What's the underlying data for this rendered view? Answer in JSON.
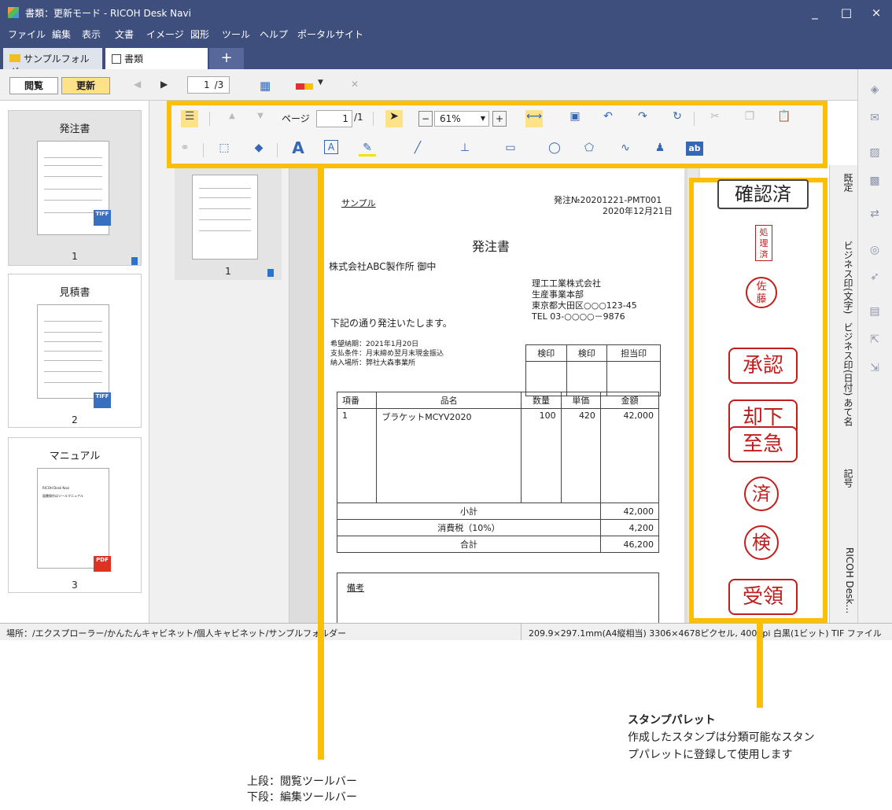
{
  "titlebar": {
    "title": "書類：更新モード - RICOH Desk Navi",
    "minimize": "_",
    "maximize": "□",
    "close": "×"
  },
  "menu": [
    "ファイル",
    "編集",
    "表示",
    "文書",
    "イメージ",
    "図形",
    "ツール",
    "ヘルプ",
    "ポータルサイト"
  ],
  "tabs": {
    "folder": "サンプルフォルダー",
    "docs": "書類",
    "add": "+"
  },
  "mainbar": {
    "browse": "閲覧",
    "update": "更新",
    "page": "1",
    "total": "/3"
  },
  "toolbar": {
    "page_label": "ページ",
    "page_value": "1",
    "page_total": "/1",
    "zoom": "61%",
    "text_tool": "A",
    "textbox_tool": "A",
    "ab_tool": "ab"
  },
  "left_docs": [
    {
      "title": "発注書",
      "number": "1",
      "format": "TIFF"
    },
    {
      "title": "見積書",
      "number": "2",
      "format": "TIFF"
    },
    {
      "title": "マニュアル",
      "number": "3",
      "format": "PDF"
    }
  ],
  "mid_thumb": {
    "number": "1"
  },
  "manual_thumb": {
    "line1": "RICOH Desk Navi",
    "line2": "図書操作はツールマニュアル"
  },
  "document": {
    "sample": "サンプル",
    "order_no": "発注№20201221-PMT001",
    "date": "2020年12月21日",
    "title": "発注書",
    "recipient": "株式会社ABC製作所  御中",
    "company": "理工工業株式会社",
    "department": "生産事業本部",
    "address": "東京都大田区○○○123-45",
    "tel": "TEL  03-○○○○－9876",
    "intro": "下記の通り発注いたします。",
    "delivery": "希望納期：2021年1月20日",
    "payment": "支払条件：月末締め翌月末現金振込",
    "place": "納入場所：弊社大森事業所",
    "approvals": [
      "検印",
      "検印",
      "担当印"
    ],
    "columns": [
      "項番",
      "品名",
      "数量",
      "単価",
      "金額"
    ],
    "rows": [
      {
        "no": "1",
        "name": "ブラケットMCYV2020",
        "qty": "100",
        "price": "420",
        "amount": "42,000"
      }
    ],
    "subtotal_label": "小計",
    "subtotal": "42,000",
    "tax_label": "消費税（10%）",
    "tax": "4,200",
    "total_label": "合計",
    "total": "46,200",
    "remarks": "備考"
  },
  "stamps": [
    "確認済",
    "処",
    "理",
    "済",
    "佐",
    "藤",
    "承認",
    "却下",
    "至急",
    "済",
    "検",
    "受領"
  ],
  "vtabs": [
    "既定",
    "ビジネス印(文字)",
    "ビジネス印(日付)",
    "あて名",
    "記号",
    "RICOH Desk…"
  ],
  "statusbar": {
    "location": "場所：/エクスプローラー/かんたんキャビネット/個人キャビネット/サンプルフォルダー",
    "info": "209.9×297.1mm(A4縦相当) 3306×4678ピクセル, 400dpi 白黒(1ビット) TIF ファイル"
  },
  "callouts": {
    "stamp_title": "スタンプパレット",
    "stamp_desc1": "作成したスタンプは分類可能なスタン",
    "stamp_desc2": "プパレットに登録して使用します",
    "toolbar_line1": "上段：閲覧ツールバー",
    "toolbar_line2": "下段：編集ツールバー"
  },
  "colors": {
    "accent": "#fbbf08",
    "titlebar": "#3f4f7d",
    "stamp_red": "#c21d1d"
  }
}
